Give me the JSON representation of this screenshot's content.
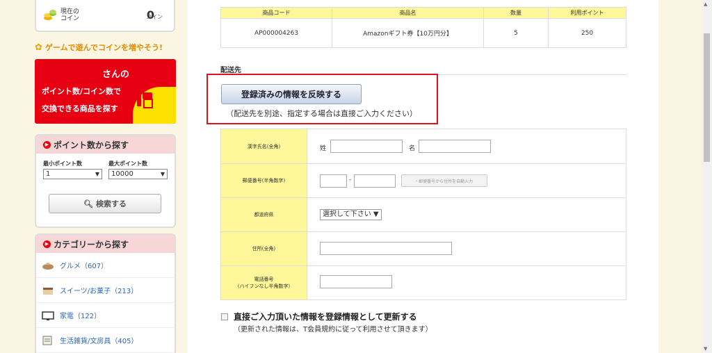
{
  "sidebar": {
    "coin": {
      "label": "現在の\nコイン",
      "value": "0",
      "unit": "コイン"
    },
    "game_link": "ゲームで遊んでコインを増やそう!",
    "banner": {
      "san": "さんの",
      "line1": "ポイント数/コイン数で",
      "line2": "交換できる商品を探す"
    },
    "points": {
      "title": "ポイント数から探す",
      "min_label": "最小ポイント数",
      "max_label": "最大ポイント数",
      "min_value": "1",
      "max_value": "10000",
      "search": "検索する"
    },
    "categories": {
      "title": "カテゴリーから探す",
      "items": [
        {
          "label": "グルメ（607）",
          "icon": "gourmet-icon"
        },
        {
          "label": "スイーツ/お菓子（213）",
          "icon": "cake-icon"
        },
        {
          "label": "家電（122）",
          "icon": "tv-icon"
        },
        {
          "label": "生活雑貨/文房具（405）",
          "icon": "stationery-icon"
        }
      ]
    }
  },
  "product": {
    "headers": [
      "商品コード",
      "商品名",
      "数量",
      "利用ポイント"
    ],
    "row": [
      "AP000004263",
      "Amazonギフト券【10万円分】",
      "5",
      "250"
    ]
  },
  "shipping": {
    "title": "配送先",
    "reflect_button": "登録済みの情報を反映する",
    "reflect_note": "（配送先を別途、指定する場合は直接ご入力ください）",
    "name_label": "漢字氏名(全角)",
    "sei": "姓",
    "mei": "名",
    "zip_label": "郵便番号(半角数字)",
    "zip_sep": "-",
    "auto_button": "郵便番号から住所を自動入力",
    "pref_label": "都道府県",
    "pref_value": "選択して下さい",
    "address_label": "住所(全角)",
    "phone_label_1": "電話番号",
    "phone_label_2": "（ハイフンなし半角数字）",
    "update_label": "直接ご入力頂いた情報を登録情報として更新する",
    "update_note": "（更新された情報は、T会員規約に従って利用させて頂きます）"
  },
  "colors": {
    "accent_red": "#e60012",
    "yellow": "#fff799",
    "link_blue": "#2a67b8"
  }
}
